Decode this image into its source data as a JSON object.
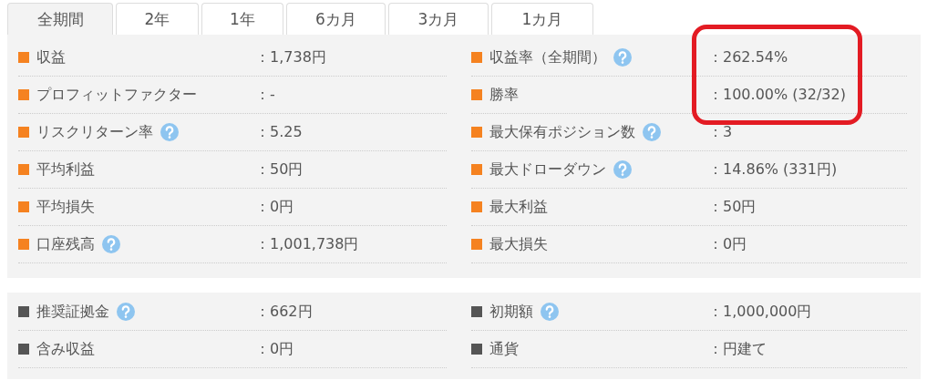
{
  "tabs": [
    {
      "label": "全期間",
      "selected": true
    },
    {
      "label": "2年",
      "selected": false
    },
    {
      "label": "1年",
      "selected": false
    },
    {
      "label": "6カ月",
      "selected": false
    },
    {
      "label": "3カ月",
      "selected": false
    },
    {
      "label": "1カ月",
      "selected": false
    }
  ],
  "sections": [
    {
      "color": "#f58220",
      "items": [
        {
          "label": "収益",
          "help": false,
          "value": "：1,738円",
          "highlighted": false
        },
        {
          "label": "収益率（全期間）",
          "help": true,
          "value": "：262.54%",
          "highlighted": true
        },
        {
          "label": "プロフィットファクター",
          "help": false,
          "value": "：-",
          "highlighted": false
        },
        {
          "label": "勝率",
          "help": false,
          "value": "：100.00% (32/32)",
          "highlighted": true
        },
        {
          "label": "リスクリターン率",
          "help": true,
          "value": "：5.25",
          "highlighted": false
        },
        {
          "label": "最大保有ポジション数",
          "help": true,
          "value": "：3",
          "highlighted": false
        },
        {
          "label": "平均利益",
          "help": false,
          "value": "：50円",
          "highlighted": false
        },
        {
          "label": "最大ドローダウン",
          "help": true,
          "value": "：14.86% (331円)",
          "highlighted": false
        },
        {
          "label": "平均損失",
          "help": false,
          "value": "：0円",
          "highlighted": false
        },
        {
          "label": "最大利益",
          "help": false,
          "value": "：50円",
          "highlighted": false
        },
        {
          "label": "口座残高",
          "help": true,
          "value": "：1,001,738円",
          "highlighted": false
        },
        {
          "label": "最大損失",
          "help": false,
          "value": "：0円",
          "highlighted": false
        }
      ]
    },
    {
      "color": "#555555",
      "items": [
        {
          "label": "推奨証拠金",
          "help": true,
          "value": "：662円",
          "highlighted": false
        },
        {
          "label": "初期額",
          "help": true,
          "value": "：1,000,000円",
          "highlighted": false
        },
        {
          "label": "含み収益",
          "help": false,
          "value": "：0円",
          "highlighted": false
        },
        {
          "label": "通貨",
          "help": false,
          "value": "：円建て",
          "highlighted": false
        }
      ]
    }
  ]
}
